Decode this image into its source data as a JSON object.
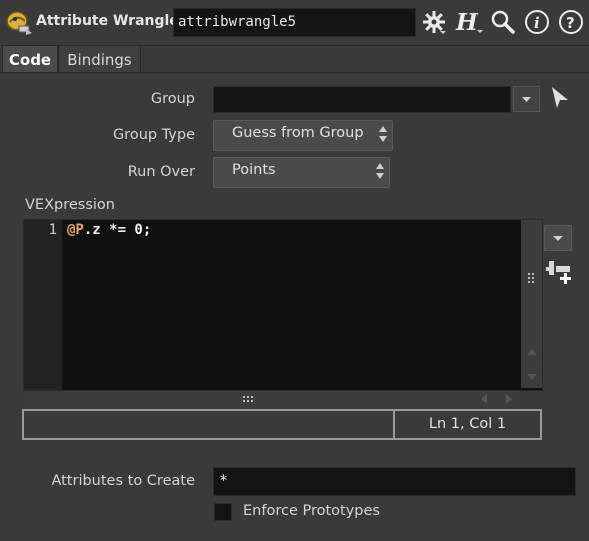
{
  "header": {
    "node_type": "Attribute Wrangle",
    "node_name": "attribwrangle5",
    "icons": [
      "node-type-icon",
      "gear-icon",
      "houdini-help-icon",
      "search-icon",
      "info-icon",
      "help-icon"
    ]
  },
  "tabs": [
    {
      "label": "Code",
      "active": true
    },
    {
      "label": "Bindings",
      "active": false
    }
  ],
  "params": {
    "group": {
      "label": "Group",
      "value": ""
    },
    "group_type": {
      "label": "Group Type",
      "value": "Guess from Group"
    },
    "run_over": {
      "label": "Run Over",
      "value": "Points"
    },
    "vexpression": {
      "label": "VEXpression",
      "line_number": "1",
      "code_attr": "@P",
      "code_rest": ".z *= 0;",
      "status": "",
      "cursor": "Ln 1, Col 1"
    },
    "attributes_to_create": {
      "label": "Attributes to Create",
      "value": "*"
    },
    "enforce_prototypes": {
      "label": "Enforce Prototypes",
      "checked": false
    }
  },
  "colors": {
    "background": "#3a3a3a",
    "field": "#141414",
    "attr_highlight": "#e8a85c"
  }
}
